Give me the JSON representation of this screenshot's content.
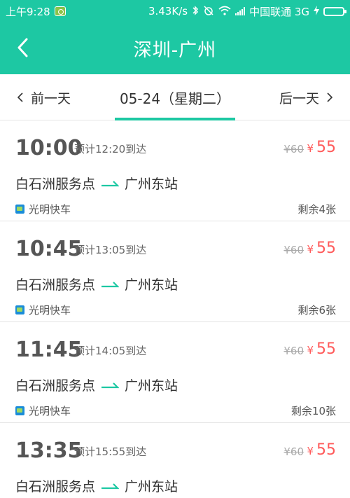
{
  "status_bar": {
    "time": "上午9:28",
    "speed": "3.43K/s",
    "carrier": "中国联通 3G"
  },
  "header": {
    "title": "深圳-广州"
  },
  "date_nav": {
    "prev_label": "前一天",
    "current_label": "05-24（星期二）",
    "next_label": "后一天"
  },
  "trips": [
    {
      "time": "10:00",
      "eta": "预计12:20到达",
      "old_price": "¥60",
      "price_symbol": "¥",
      "price": "55",
      "from": "白石洲服务点",
      "to": "广州东站",
      "company": "光明快车",
      "remaining": "剩余4张"
    },
    {
      "time": "10:45",
      "eta": "预计13:05到达",
      "old_price": "¥60",
      "price_symbol": "¥",
      "price": "55",
      "from": "白石洲服务点",
      "to": "广州东站",
      "company": "光明快车",
      "remaining": "剩余6张"
    },
    {
      "time": "11:45",
      "eta": "预计14:05到达",
      "old_price": "¥60",
      "price_symbol": "¥",
      "price": "55",
      "from": "白石洲服务点",
      "to": "广州东站",
      "company": "光明快车",
      "remaining": "剩余10张"
    },
    {
      "time": "13:35",
      "eta": "预计15:55到达",
      "old_price": "¥60",
      "price_symbol": "¥",
      "price": "55",
      "from": "白石洲服务点",
      "to": "广州东站",
      "company": "",
      "remaining": ""
    }
  ],
  "colors": {
    "accent": "#1dc8a3",
    "price": "#ff5a5a"
  }
}
